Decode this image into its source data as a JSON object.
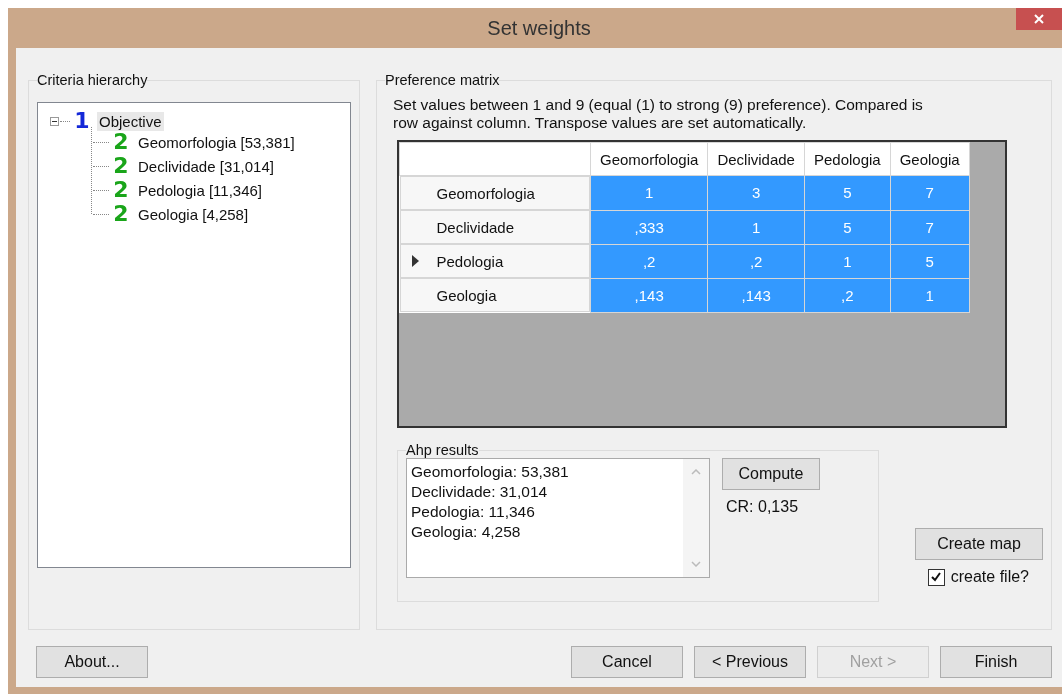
{
  "window": {
    "title": "Set weights"
  },
  "criteria_hierarchy": {
    "title": "Criteria hierarchy",
    "tree": [
      {
        "badge": "1",
        "label": "Objective",
        "selected": true,
        "expanded": true,
        "children": [
          {
            "badge": "2",
            "label": "Geomorfologia [53,381]",
            "selected": false
          },
          {
            "badge": "2",
            "label": "Declividade [31,014]",
            "selected": false
          },
          {
            "badge": "2",
            "label": "Pedologia [11,346]",
            "selected": false
          },
          {
            "badge": "2",
            "label": "Geologia [4,258]",
            "selected": false
          }
        ]
      }
    ]
  },
  "preference_matrix": {
    "title": "Preference matrix",
    "instructions": "Set values between 1 and 9 (equal (1) to strong (9) preference). Compared is row against column. Transpose values are set automatically.",
    "columns": [
      "Geomorfologia",
      "Declividade",
      "Pedologia",
      "Geologia"
    ],
    "rows": [
      {
        "header": "Geomorfologia",
        "current": false,
        "selected": true,
        "cells": [
          "1",
          "3",
          "5",
          "7"
        ]
      },
      {
        "header": "Declividade",
        "current": false,
        "selected": true,
        "cells": [
          ",333",
          "1",
          "5",
          "7"
        ]
      },
      {
        "header": "Pedologia",
        "current": true,
        "selected": true,
        "cells": [
          ",2",
          ",2",
          "1",
          "5"
        ]
      },
      {
        "header": "Geologia",
        "current": false,
        "selected": true,
        "cells": [
          ",143",
          ",143",
          ",2",
          "1"
        ]
      }
    ]
  },
  "ahp_results": {
    "title": "Ahp results",
    "lines": [
      "Geomorfologia: 53,381",
      "Declividade: 31,014",
      "Pedologia: 11,346",
      "Geologia: 4,258"
    ],
    "compute_button": "Compute",
    "cr": "CR: 0,135"
  },
  "create_map_button": "Create  map",
  "create_file": {
    "label": "create file?",
    "checked": true
  },
  "buttons": [
    {
      "label": "About...",
      "disabled": false
    },
    {
      "label": "Cancel",
      "disabled": false
    },
    {
      "label": "< Previous",
      "disabled": false
    },
    {
      "label": "Next >",
      "disabled": true
    },
    {
      "label": "Finish",
      "disabled": false
    }
  ]
}
